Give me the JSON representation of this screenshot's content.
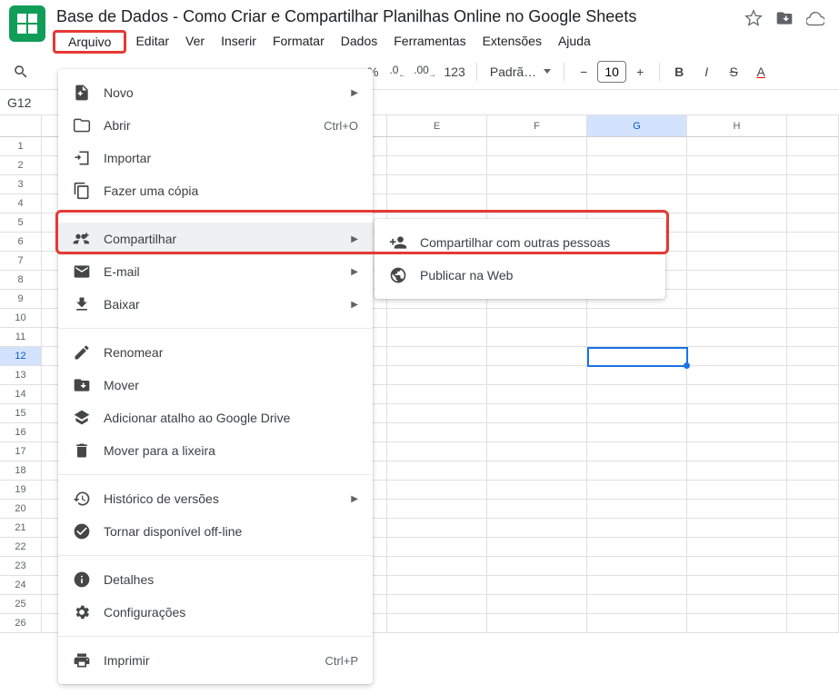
{
  "doc_title": "Base de Dados - Como Criar e Compartilhar Planilhas Online no Google Sheets",
  "menubar": [
    "Arquivo",
    "Editar",
    "Ver",
    "Inserir",
    "Formatar",
    "Dados",
    "Ferramentas",
    "Extensões",
    "Ajuda"
  ],
  "toolbar": {
    "percent": "%",
    "dec_dec": ".0",
    "dec_inc": ".00",
    "num_fmt": "123",
    "font": "Padrã…",
    "minus": "−",
    "size": "10",
    "plus": "+"
  },
  "namebox": "G12",
  "columns": [
    "E",
    "F",
    "G",
    "H"
  ],
  "selected_col": "G",
  "rows": [
    "1",
    "2",
    "3",
    "4",
    "5",
    "6",
    "7",
    "8",
    "9",
    "10",
    "11",
    "12",
    "13",
    "14",
    "15",
    "16",
    "17",
    "18",
    "19",
    "20",
    "21",
    "22",
    "23",
    "24",
    "25",
    "26"
  ],
  "selected_row": "12",
  "file_menu": {
    "novo": "Novo",
    "abrir": "Abrir",
    "abrir_shortcut": "Ctrl+O",
    "importar": "Importar",
    "copia": "Fazer uma cópia",
    "compartilhar": "Compartilhar",
    "email": "E-mail",
    "baixar": "Baixar",
    "renomear": "Renomear",
    "mover": "Mover",
    "atalho": "Adicionar atalho ao Google Drive",
    "lixeira": "Mover para a lixeira",
    "historico": "Histórico de versões",
    "offline": "Tornar disponível off-line",
    "detalhes": "Detalhes",
    "config": "Configurações",
    "imprimir": "Imprimir",
    "imprimir_shortcut": "Ctrl+P"
  },
  "share_submenu": {
    "pessoas": "Compartilhar com outras pessoas",
    "web": "Publicar na Web"
  }
}
